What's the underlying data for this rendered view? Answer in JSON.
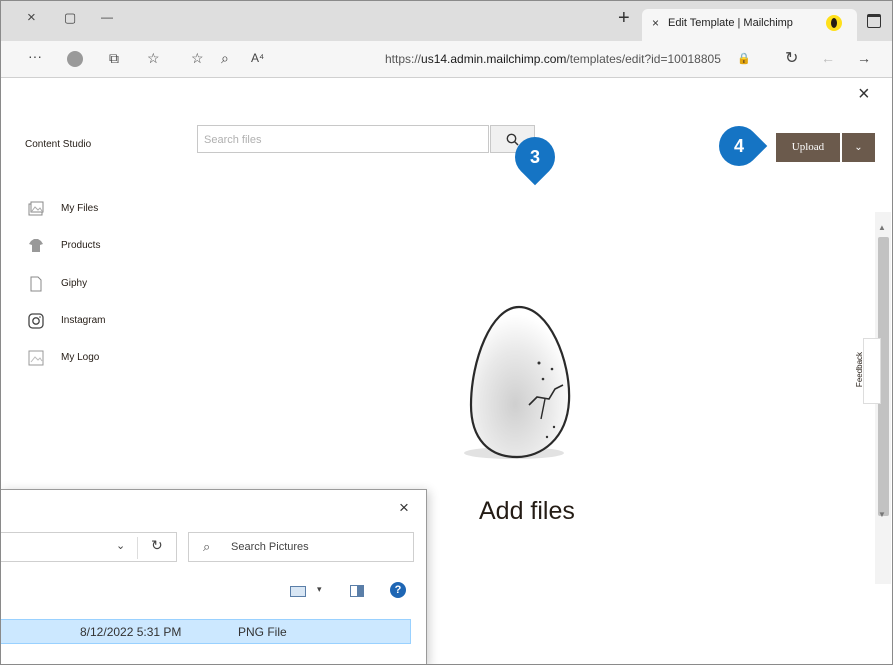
{
  "browser": {
    "tab_title": "Edit Template | Mailchimp",
    "url_prefix": "https://",
    "url_domain": "us14.admin.mailchimp.com",
    "url_path": "/templates/edit?id=10018805",
    "new_tab_glyph": "+",
    "tab_close_glyph": "×",
    "window_controls": {
      "close": "×",
      "maximize": "▢",
      "minimize": "—"
    },
    "toolbar_icons": [
      "more-icon",
      "profile-icon",
      "collections-icon",
      "favorites-icon",
      "add-favorite-icon",
      "zoom-icon",
      "read-aloud-icon"
    ],
    "toolbar_glyphs": {
      "more": "···",
      "collections": "⧉",
      "favorites": "☆",
      "add_favorite": "☆",
      "zoom": "⌕",
      "read_aloud": "A⁴",
      "lock": "🔒",
      "refresh": "↻",
      "back": "←",
      "forward": "→"
    }
  },
  "studio": {
    "title": "Content Studio",
    "close_glyph": "×",
    "search_placeholder": "Search files",
    "upload_label": "Upload",
    "upload_dropdown_glyph": "⌄",
    "nav": [
      {
        "label": "My Files",
        "icon": "folder-image-icon"
      },
      {
        "label": "Products",
        "icon": "shirt-icon"
      },
      {
        "label": "Giphy",
        "icon": "giphy-icon"
      },
      {
        "label": "Instagram",
        "icon": "instagram-icon"
      },
      {
        "label": "My Logo",
        "icon": "logo-image-icon"
      }
    ],
    "empty_state_text": "Add files",
    "feedback_label": "Feedback"
  },
  "callouts": {
    "step3": "3",
    "step4": "4",
    "color": "#1574c4"
  },
  "file_dialog": {
    "close_glyph": "×",
    "path_chevron": "⌄",
    "refresh_glyph": "↻",
    "search_placeholder": "Search Pictures",
    "help_glyph": "?",
    "view_dropdown_glyph": "▾",
    "file_row": {
      "date": "8/12/2022 5:31 PM",
      "type": "PNG File"
    }
  },
  "colors": {
    "upload_button": "#6b5a4c",
    "selected_row": "#cce8ff",
    "accent": "#1574c4"
  }
}
